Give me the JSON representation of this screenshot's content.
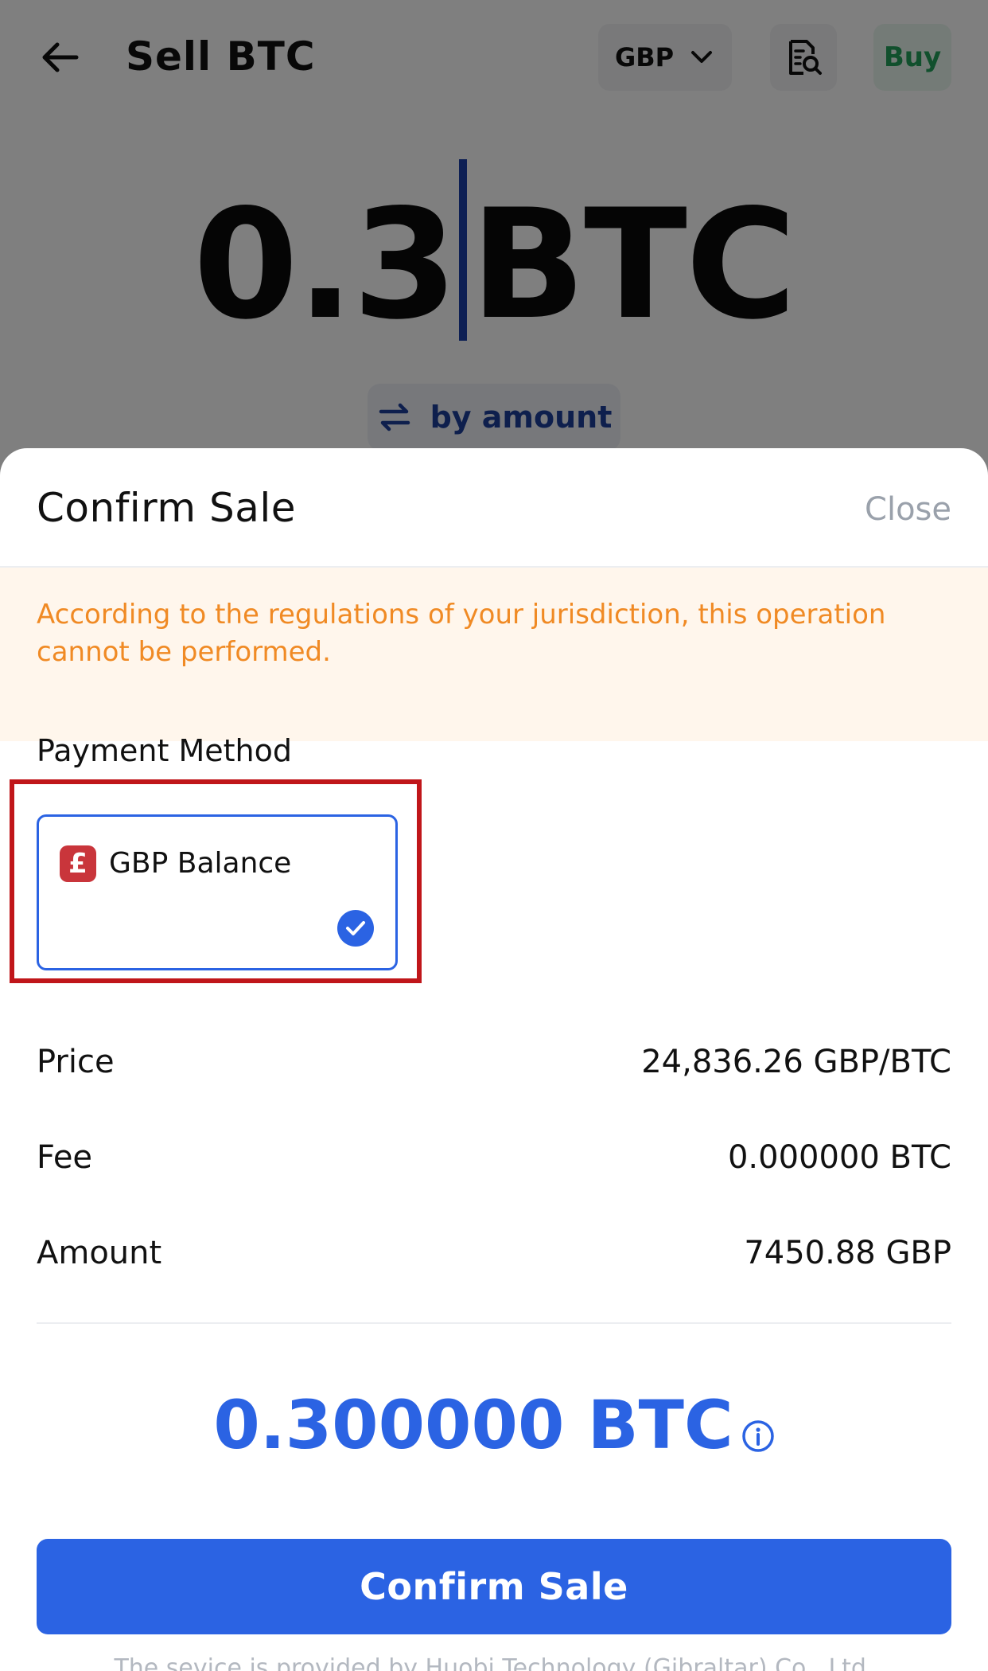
{
  "header": {
    "title": "Sell BTC",
    "currency": "GBP",
    "buy_label": "Buy"
  },
  "amount_input": {
    "value": "0.3",
    "unit": "BTC",
    "toggle_label": "by amount"
  },
  "sheet": {
    "title": "Confirm Sale",
    "close_label": "Close",
    "warning": "According to the regulations of your jurisdiction, this operation cannot be performed.",
    "payment_method_label": "Payment Method",
    "payment_method": {
      "name": "GBP Balance",
      "icon_symbol": "£",
      "selected": true
    },
    "details": [
      {
        "label": "Price",
        "value": "24,836.26 GBP/BTC"
      },
      {
        "label": "Fee",
        "value": "0.000000 BTC"
      },
      {
        "label": "Amount",
        "value": "7450.88 GBP"
      }
    ],
    "total": "0.300000 BTC",
    "confirm_label": "Confirm Sale",
    "footer_note": "The sevice is provided by Huobi Technology (Gibraltar) Co., Ltd."
  },
  "colors": {
    "accent": "#2b63e3",
    "warning_text": "#f08a24",
    "warning_bg": "#fff6ec",
    "buy_green": "#22a05a",
    "highlight_red": "#c0161a"
  }
}
